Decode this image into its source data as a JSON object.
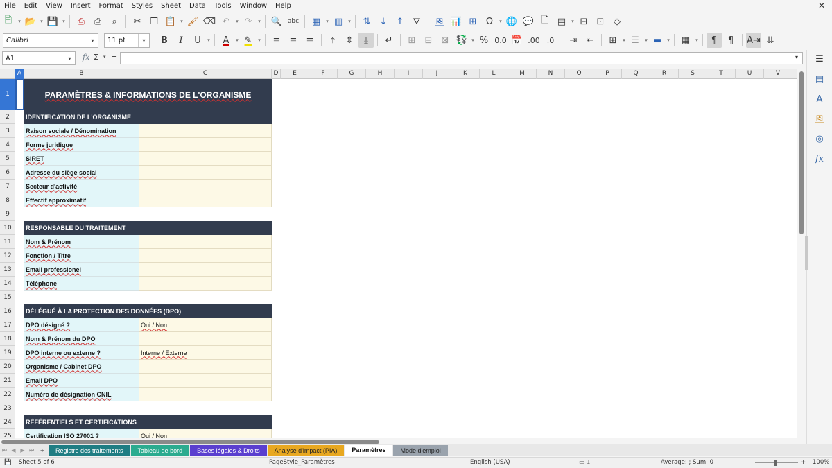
{
  "menu": [
    "File",
    "Edit",
    "View",
    "Insert",
    "Format",
    "Styles",
    "Sheet",
    "Data",
    "Tools",
    "Window",
    "Help"
  ],
  "font": {
    "name": "Calibri",
    "size": "11 pt"
  },
  "namebox": "A1",
  "formula": {
    "fx": "fx",
    "sigma": "Σ",
    "equals": "="
  },
  "columns": [
    "A",
    "B",
    "C",
    "D",
    "E",
    "F",
    "G",
    "H",
    "I",
    "J",
    "K",
    "L",
    "M",
    "N",
    "O",
    "P",
    "Q",
    "R",
    "S",
    "T",
    "U",
    "V"
  ],
  "rows": [
    "1",
    "2",
    "3",
    "4",
    "5",
    "6",
    "7",
    "8",
    "9",
    "10",
    "11",
    "12",
    "13",
    "14",
    "15",
    "16",
    "17",
    "18",
    "19",
    "20",
    "21",
    "22",
    "23",
    "24",
    "25"
  ],
  "sheet": {
    "title": "PARAMÈTRES & INFORMATIONS DE L'ORGANISME",
    "sections": [
      {
        "title": "IDENTIFICATION DE L'ORGANISME",
        "rows": [
          {
            "label": "Raison sociale / Dénomination",
            "value": ""
          },
          {
            "label": "Forme juridique",
            "value": ""
          },
          {
            "label": "SIRET",
            "value": ""
          },
          {
            "label": "Adresse du siège social",
            "value": ""
          },
          {
            "label": "Secteur d'activité",
            "value": ""
          },
          {
            "label": "Effectif approximatif",
            "value": ""
          }
        ]
      },
      {
        "title": "RESPONSABLE DU TRAITEMENT",
        "rows": [
          {
            "label": "Nom & Prénom",
            "value": ""
          },
          {
            "label": "Fonction / Titre",
            "value": ""
          },
          {
            "label": "Email professionel",
            "value": ""
          },
          {
            "label": "Téléphone",
            "value": ""
          }
        ]
      },
      {
        "title": "DÉLÉGUÉ À LA PROTECTION DES DONNÉES (DPO)",
        "rows": [
          {
            "label": "DPO désigné ?",
            "value": "Oui / Non"
          },
          {
            "label": "Nom & Prénom du DPO",
            "value": ""
          },
          {
            "label": "DPO interne ou externe ?",
            "value": "Interne / Externe"
          },
          {
            "label": "Organisme / Cabinet DPO",
            "value": ""
          },
          {
            "label": "Email DPO",
            "value": ""
          },
          {
            "label": "Numéro de désignation CNIL",
            "value": ""
          }
        ]
      },
      {
        "title": "RÉFÉRENTIELS ET CERTIFICATIONS",
        "rows": [
          {
            "label": "Certification ISO 27001 ?",
            "value": "Oui / Non"
          }
        ]
      }
    ]
  },
  "tabs": [
    {
      "label": "Registre des traitements",
      "color": "#1f7d83",
      "text": "#ffffff",
      "active": false
    },
    {
      "label": "Tableau de bord",
      "color": "#2bab8f",
      "text": "#ffffff",
      "active": false
    },
    {
      "label": "Bases légales & Droits",
      "color": "#5a3fcf",
      "text": "#ffffff",
      "active": false
    },
    {
      "label": "Analyse d'impact (PIA)",
      "color": "#e8a820",
      "text": "#222222",
      "active": false
    },
    {
      "label": "Paramètres",
      "color": "#ffffff",
      "text": "#111111",
      "active": true
    },
    {
      "label": "Mode d'emploi",
      "color": "#9aa3ad",
      "text": "#222222",
      "active": false
    }
  ],
  "tab_add": "+",
  "status": {
    "sheet": "Sheet 5 of 6",
    "pagestyle": "PageStyle_Paramètres",
    "language": "English (USA)",
    "summary": "Average: ; Sum: 0",
    "zoom": "100%"
  },
  "colors": {
    "header_dark": "#323c4e",
    "label_bg": "#e2f6f9",
    "value_bg": "#fdf9e6",
    "selection": "#3576d5"
  }
}
